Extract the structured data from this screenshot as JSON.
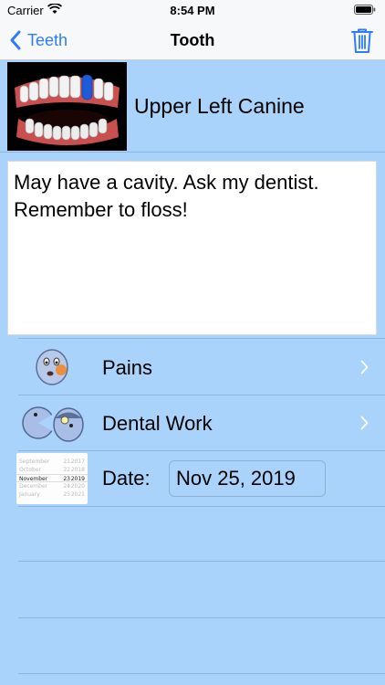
{
  "status_bar": {
    "carrier": "Carrier",
    "time": "8:54 PM"
  },
  "nav": {
    "back_label": "Teeth",
    "title": "Tooth"
  },
  "tooth": {
    "name": "Upper Left Canine",
    "notes": "May have a cavity. Ask my dentist. Remember to floss!"
  },
  "rows": [
    {
      "label": "Pains",
      "icon": "face-pain-icon"
    },
    {
      "label": "Dental Work",
      "icon": "dental-tools-icon"
    }
  ],
  "date": {
    "label": "Date:",
    "value": "Nov 25, 2019",
    "picker_rows": [
      [
        "September",
        "21",
        "2017"
      ],
      [
        "October",
        "22",
        "2018"
      ],
      [
        "November",
        "23",
        "2019"
      ],
      [
        "December",
        "24",
        "2020"
      ],
      [
        "January",
        "25",
        "2021"
      ]
    ]
  },
  "colors": {
    "background": "#a9d3fb",
    "accent": "#2f7cf6",
    "selected_tooth": "#1e5bd8"
  }
}
